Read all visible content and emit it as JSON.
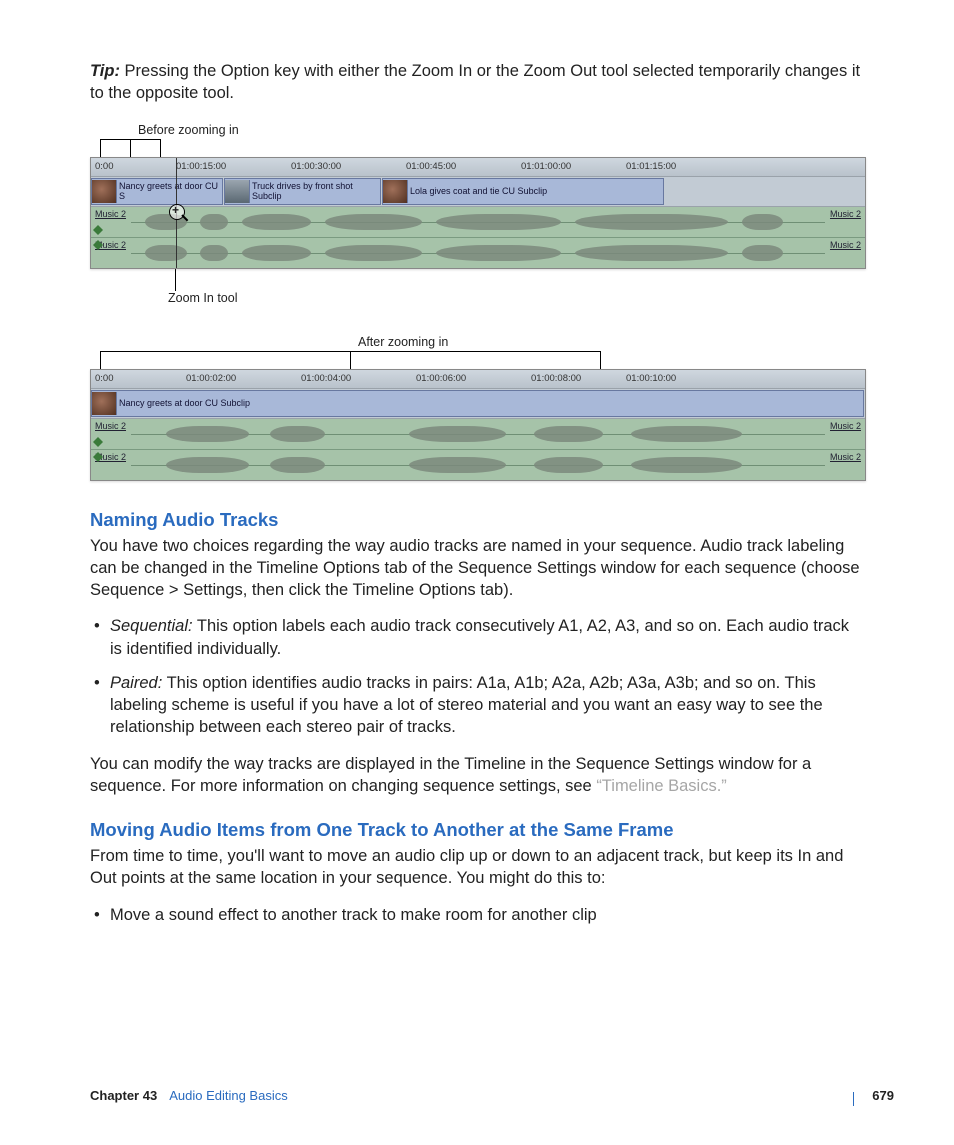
{
  "tip": {
    "label": "Tip:",
    "text": "Pressing the Option key with either the Zoom In or the Zoom Out tool selected temporarily changes it to the opposite tool."
  },
  "fig1": {
    "callout_before": "Before zooming in",
    "callout_zoom": "Zoom In tool",
    "ruler": [
      "0:00",
      "01:00:15:00",
      "01:00:30:00",
      "01:00:45:00",
      "01:01:00:00",
      "01:01:15:00"
    ],
    "clips": [
      {
        "label": "Nancy greets at door CU S"
      },
      {
        "label": "Truck drives by front shot Subclip"
      },
      {
        "label": "Lola gives coat and tie CU Subclip"
      }
    ],
    "audio_label": "Music 2"
  },
  "fig2": {
    "callout_after": "After zooming in",
    "ruler": [
      "0:00",
      "01:00:02:00",
      "01:00:04:00",
      "01:00:06:00",
      "01:00:08:00",
      "01:00:10:00"
    ],
    "clip": {
      "label": "Nancy greets at door CU Subclip"
    },
    "audio_label": "Music 2"
  },
  "section_naming": {
    "heading": "Naming Audio Tracks",
    "body": "You have two choices regarding the way audio tracks are named in your sequence. Audio track labeling can be changed in the Timeline Options tab of the Sequence Settings window for each sequence (choose Sequence > Settings, then click the Timeline Options tab).",
    "items": [
      {
        "term": "Sequential:",
        "text": "This option labels each audio track consecutively A1, A2, A3, and so on. Each audio track is identified individually."
      },
      {
        "term": "Paired:",
        "text": "This option identifies audio tracks in pairs: A1a, A1b; A2a, A2b; A3a, A3b; and so on. This labeling scheme is useful if you have a lot of stereo material and you want an easy way to see the relationship between each stereo pair of tracks."
      }
    ],
    "body2_a": "You can modify the way tracks are displayed in the Timeline in the Sequence Settings window for a sequence. For more information on changing sequence settings, see ",
    "body2_link": "“Timeline Basics.”"
  },
  "section_moving": {
    "heading": "Moving Audio Items from One Track to Another at the Same Frame",
    "body": "From time to time, you'll want to move an audio clip up or down to an adjacent track, but keep its In and Out points at the same location in your sequence. You might do this to:",
    "items": [
      {
        "text": "Move a sound effect to another track to make room for another clip"
      }
    ]
  },
  "footer": {
    "chapter": "Chapter 43",
    "title": "Audio Editing Basics",
    "page": "679"
  }
}
